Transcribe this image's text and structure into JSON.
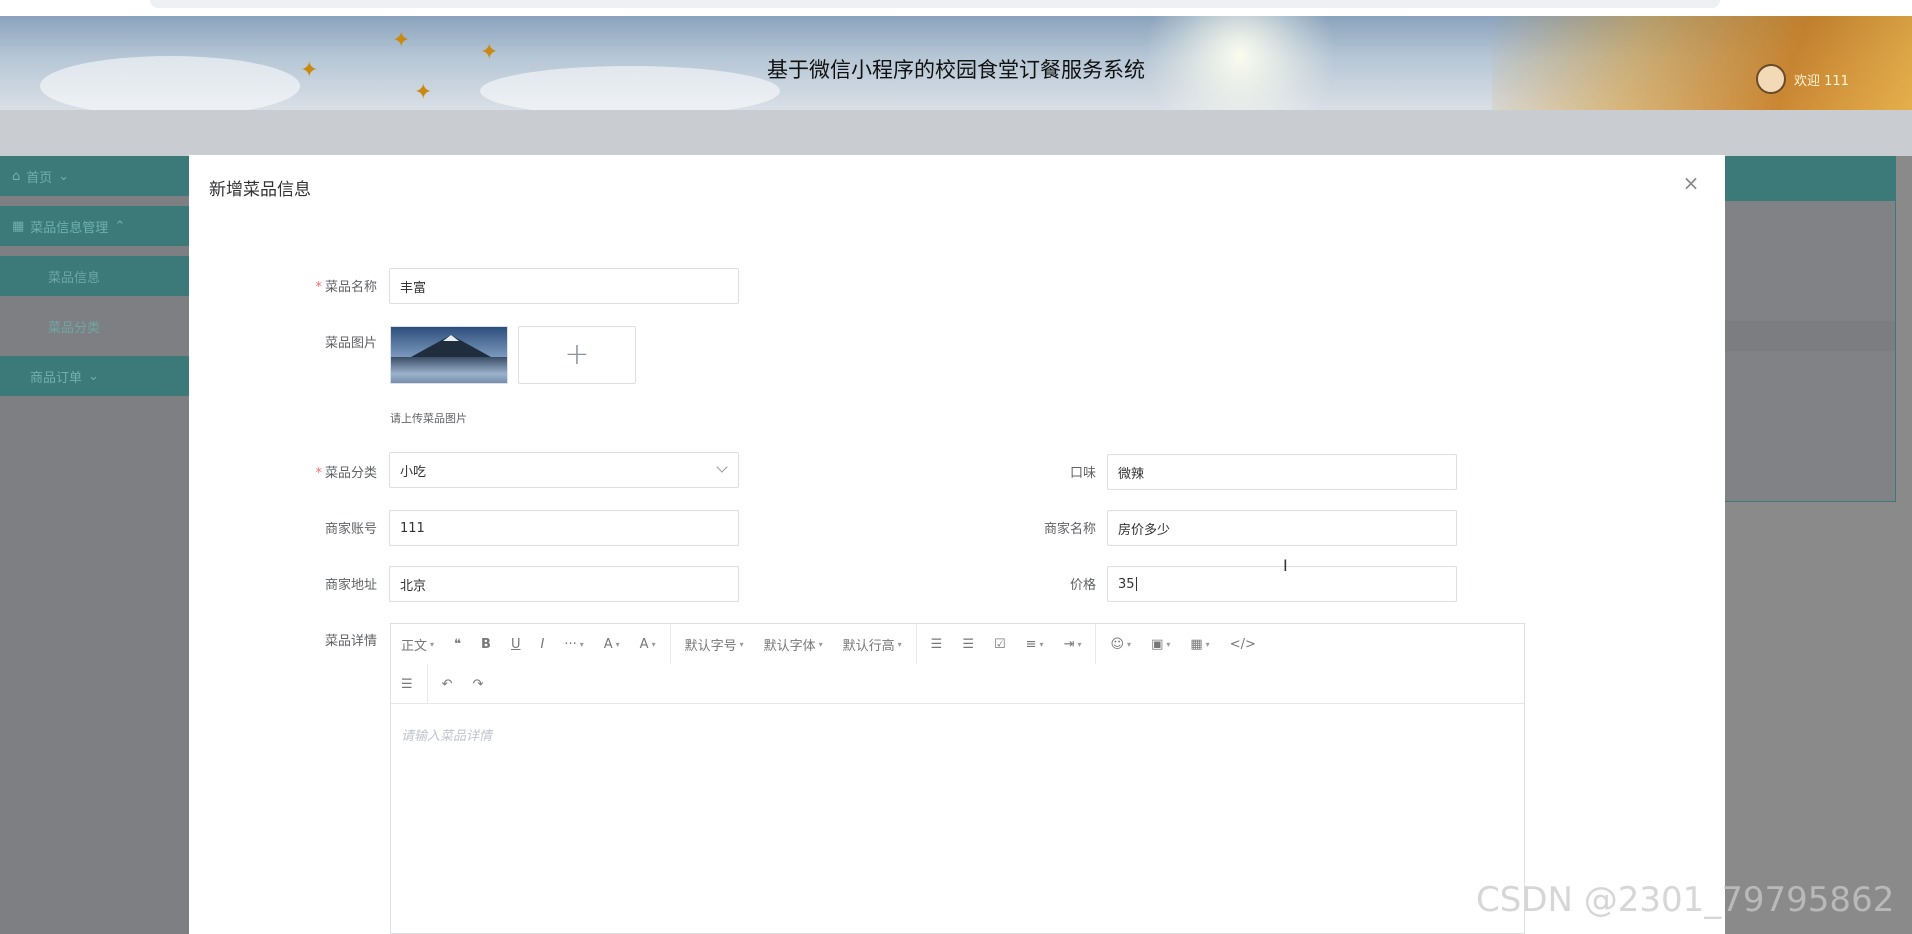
{
  "app": {
    "title": "基于微信小程序的校园食堂订餐服务系统",
    "welcome": "欢迎 111"
  },
  "sidebar": {
    "items": [
      {
        "label": "首页",
        "icon": "home-icon"
      },
      {
        "label": "菜品信息管理",
        "icon": "grid-icon"
      },
      {
        "label": "菜品信息"
      },
      {
        "label": "菜品分类"
      },
      {
        "label": "商品订单"
      }
    ]
  },
  "modal": {
    "title": "新增菜品信息",
    "close_icon": "close-icon",
    "fields": {
      "name": {
        "label": "菜品名称",
        "value": "丰富",
        "required": true
      },
      "image": {
        "label": "菜品图片",
        "tip": "请上传菜品图片"
      },
      "category": {
        "label": "菜品分类",
        "value": "小吃",
        "required": true
      },
      "taste": {
        "label": "口味",
        "value": "微辣"
      },
      "merchant_account": {
        "label": "商家账号",
        "value": "111"
      },
      "merchant_name": {
        "label": "商家名称",
        "value": "房价多少"
      },
      "merchant_address": {
        "label": "商家地址",
        "value": "北京"
      },
      "price": {
        "label": "价格",
        "value": "35"
      },
      "detail": {
        "label": "菜品详情",
        "placeholder": "请输入菜品详情"
      }
    },
    "editor_toolbar": {
      "row1": [
        "正文",
        "❝",
        "B",
        "U",
        "I",
        "···",
        "A",
        "A",
        "默认字号",
        "默认字体",
        "默认行高",
        "☰",
        "☰",
        "☑",
        "≡",
        "⇥",
        "☺",
        "▣",
        "▦",
        "</>"
      ],
      "row2": [
        "☰",
        "↶",
        "↷"
      ]
    }
  },
  "watermark": "CSDN @2301_79795862"
}
